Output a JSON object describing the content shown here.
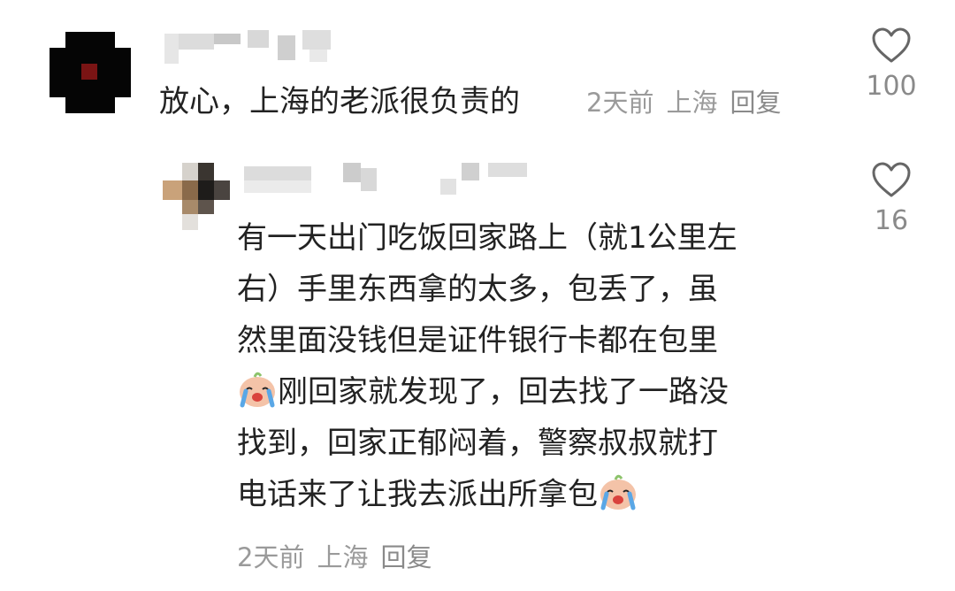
{
  "comments": [
    {
      "text": "放心，上海的老派很负责的",
      "time": "2天前",
      "location": "上海",
      "reply_label": "回复",
      "likes": "100"
    },
    {
      "line1": "有一天出门吃饭回家路上（就1公里左",
      "line2": "右）手里东西拿的太多，包丢了，虽",
      "line3": "然里面没钱但是证件银行卡都在包里",
      "line4": "刚回家就发现了，回去找了一路没",
      "line5": "找到，回家正郁闷着，警察叔叔就打",
      "line6": "电话来了让我去派出所拿包",
      "emoji": "crying-face",
      "time": "2天前",
      "location": "上海",
      "reply_label": "回复",
      "likes": "16"
    }
  ],
  "colors": {
    "text": "#222222",
    "meta": "#9a9a9a",
    "icon": "#666666"
  }
}
